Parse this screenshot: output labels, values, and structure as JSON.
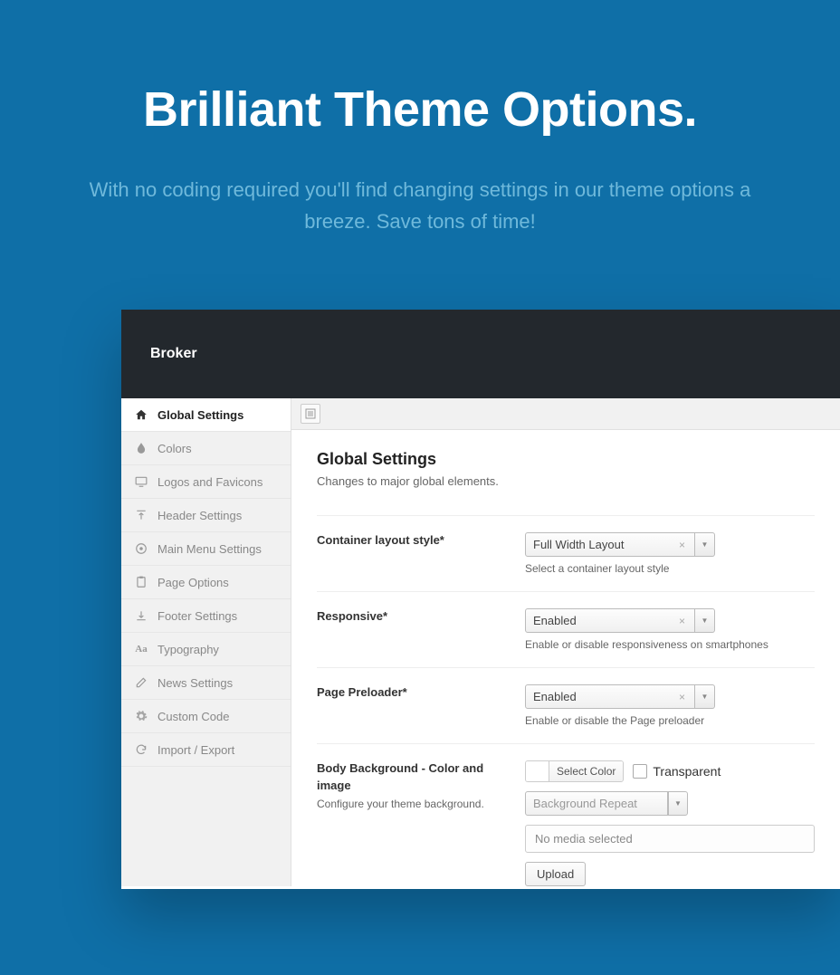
{
  "hero": {
    "title": "Brilliant Theme Options.",
    "subtitle": "With no coding required you'll find changing settings in our theme options a breeze. Save tons of time!"
  },
  "panel": {
    "brand": "Broker"
  },
  "sidebar": {
    "items": [
      {
        "label": "Global Settings",
        "icon": "home",
        "active": true
      },
      {
        "label": "Colors",
        "icon": "drop",
        "active": false
      },
      {
        "label": "Logos and Favicons",
        "icon": "monitor",
        "active": false
      },
      {
        "label": "Header Settings",
        "icon": "pointer-up",
        "active": false
      },
      {
        "label": "Main Menu Settings",
        "icon": "gear-circle",
        "active": false
      },
      {
        "label": "Page Options",
        "icon": "clipboard",
        "active": false
      },
      {
        "label": "Footer Settings",
        "icon": "pointer-down",
        "active": false
      },
      {
        "label": "Typography",
        "icon": "aa",
        "active": false
      },
      {
        "label": "News Settings",
        "icon": "edit",
        "active": false
      },
      {
        "label": "Custom Code",
        "icon": "cog",
        "active": false
      },
      {
        "label": "Import / Export",
        "icon": "refresh",
        "active": false
      }
    ]
  },
  "main": {
    "title": "Global Settings",
    "description": "Changes to major global elements.",
    "fields": {
      "container": {
        "label": "Container layout style*",
        "value": "Full Width Layout",
        "help": "Select a container layout style"
      },
      "responsive": {
        "label": "Responsive*",
        "value": "Enabled",
        "help": "Enable or disable responsiveness on smartphones"
      },
      "preloader": {
        "label": "Page Preloader*",
        "value": "Enabled",
        "help": "Enable or disable the Page preloader"
      },
      "bodybg": {
        "label": "Body Background - Color and image",
        "sublabel": "Configure your theme background.",
        "select_color": "Select Color",
        "transparent": "Transparent",
        "repeat_placeholder": "Background Repeat",
        "no_media": "No media selected",
        "upload": "Upload"
      }
    }
  }
}
